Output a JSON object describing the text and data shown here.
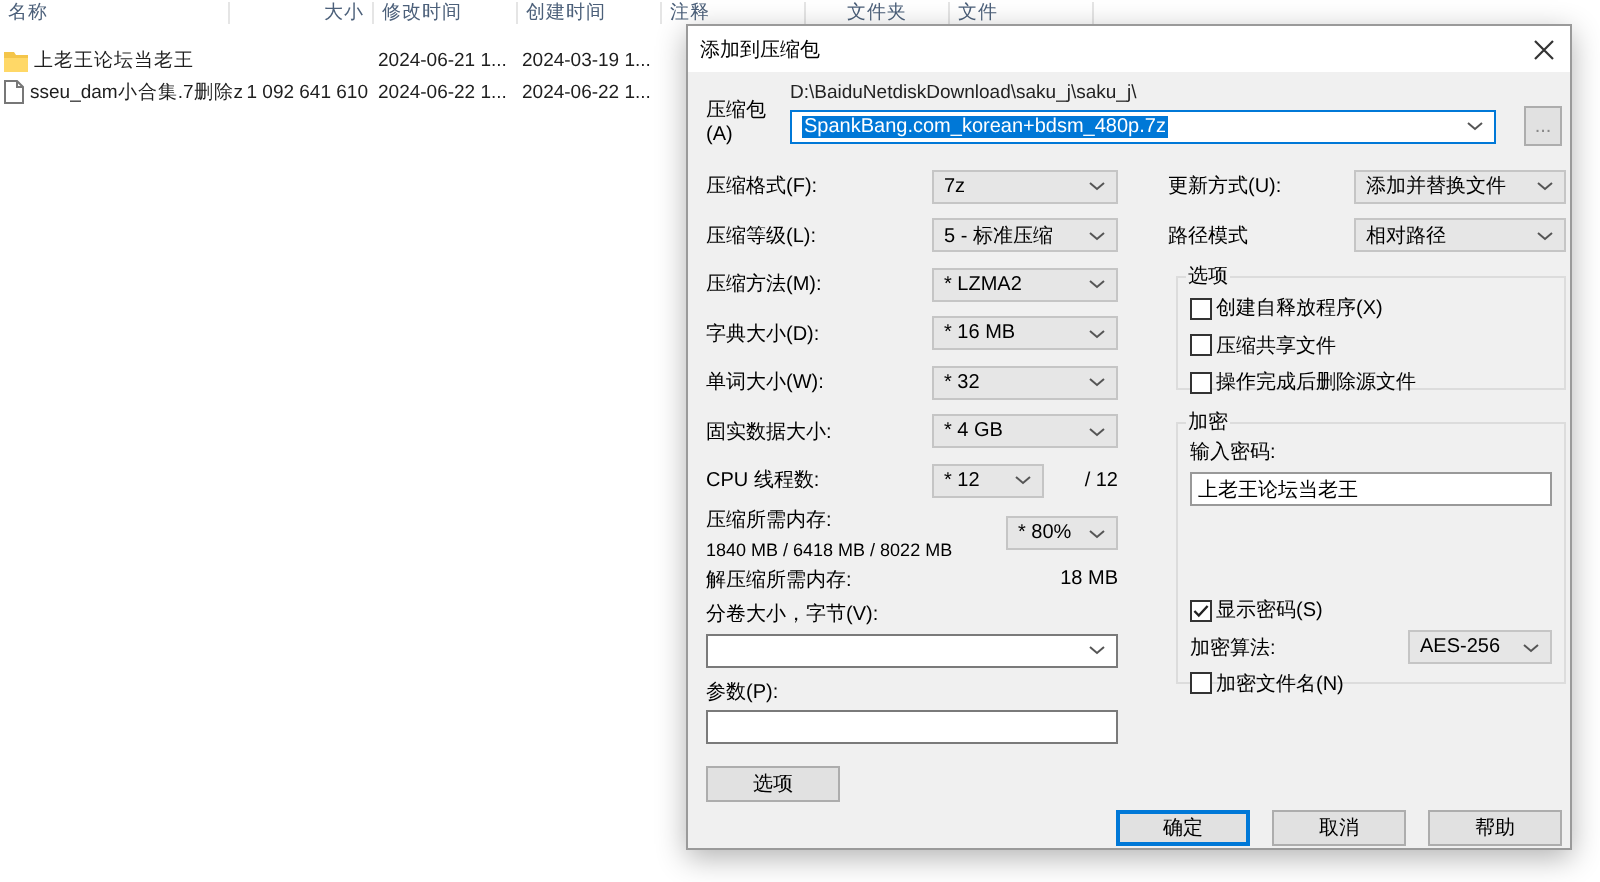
{
  "file_list": {
    "columns": [
      "名称",
      "大小",
      "修改时间",
      "创建时间",
      "注释",
      "文件夹",
      "文件"
    ],
    "rows": [
      {
        "kind": "folder",
        "name": "上老王论坛当老王",
        "modified": "2024-06-21 1...",
        "created": "2024-03-19 1..."
      },
      {
        "kind": "file",
        "name": "sseu_dam小合集.7删除z",
        "size": "1 092 641 610",
        "modified": "2024-06-22 1...",
        "created": "2024-06-22 1..."
      }
    ]
  },
  "dialog": {
    "title": "添加到压缩包",
    "archive": {
      "label": "压缩包(A)",
      "path": "D:\\BaiduNetdiskDownload\\saku_j\\saku_j\\",
      "value": "SpankBang.com_korean+bdsm_480p.7z",
      "text_selected": true
    },
    "browse_button": "...",
    "left_settings": [
      {
        "label": "压缩格式(F):",
        "value": "7z"
      },
      {
        "label": "压缩等级(L):",
        "value": "5 - 标准压缩"
      },
      {
        "label": "压缩方法(M):",
        "value": "* LZMA2"
      },
      {
        "label": "字典大小(D):",
        "value": "* 16 MB"
      },
      {
        "label": "单词大小(W):",
        "value": "* 32"
      },
      {
        "label": "固实数据大小:",
        "value": "* 4 GB"
      }
    ],
    "cpu": {
      "label": "CPU 线程数:",
      "value": "* 12",
      "max": "/ 12"
    },
    "memory": {
      "label": "压缩所需内存:",
      "detail": "1840 MB / 6418 MB / 8022 MB",
      "value": "* 80%"
    },
    "decompress_memory": {
      "label": "解压缩所需内存:",
      "value": "18 MB"
    },
    "volume": {
      "label": "分卷大小，字节(V):"
    },
    "parameters": {
      "label": "参数(P):"
    },
    "options_button": "选项",
    "right_settings": [
      {
        "label": "更新方式(U):",
        "value": "添加并替换文件"
      },
      {
        "label": "路径模式",
        "value": "相对路径"
      }
    ],
    "options_group": {
      "title": "选项",
      "items": [
        {
          "label": "创建自释放程序(X)",
          "checked": false
        },
        {
          "label": "压缩共享文件",
          "checked": false
        },
        {
          "label": "操作完成后删除源文件",
          "checked": false
        }
      ]
    },
    "encryption": {
      "title": "加密",
      "password_label": "输入密码:",
      "password": "上老王论坛当老王",
      "show_password": {
        "label": "显示密码(S)",
        "checked": true
      },
      "method": {
        "label": "加密算法:",
        "value": "AES-256"
      },
      "encrypt_names": {
        "label": "加密文件名(N)",
        "checked": false
      }
    },
    "buttons": [
      {
        "label": "确定",
        "default": true
      },
      {
        "label": "取消",
        "default": false
      },
      {
        "label": "帮助",
        "default": false
      }
    ]
  }
}
